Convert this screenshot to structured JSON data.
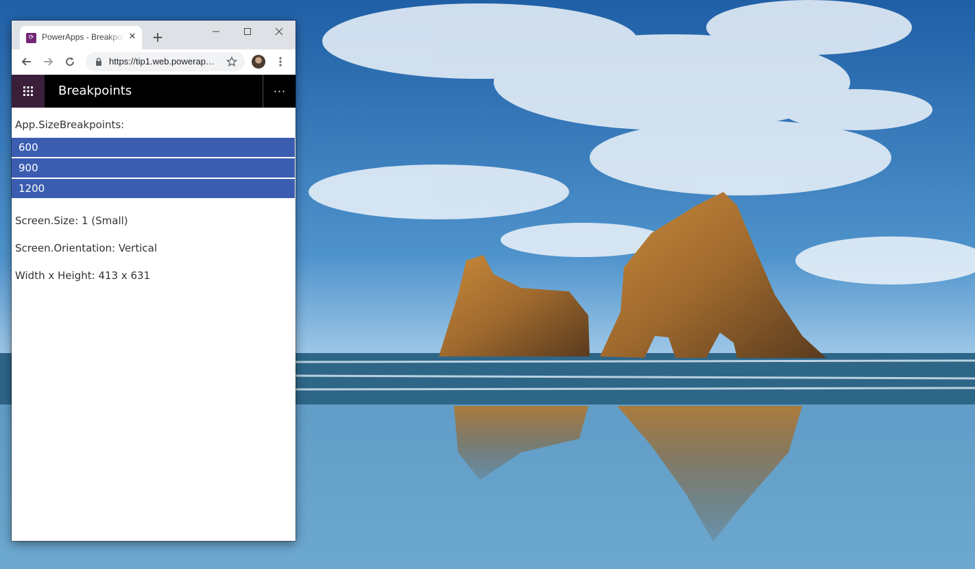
{
  "browser": {
    "tab_title": "PowerApps - Breakpoints",
    "tab_favicon": "powerapps-icon",
    "url": "https://tip1.web.powerapps.com",
    "icons": [
      "back-arrow-icon",
      "forward-arrow-icon",
      "reload-icon",
      "lock-icon",
      "star-icon",
      "profile-avatar",
      "more-menu-icon",
      "close-icon",
      "plus-icon",
      "minimize-icon",
      "maximize-icon"
    ]
  },
  "app": {
    "title": "Breakpoints",
    "more_label": "···",
    "breakpoints_label": "App.SizeBreakpoints:",
    "breakpoints": [
      "600",
      "900",
      "1200"
    ],
    "screen_size": "Screen.Size: 1 (Small)",
    "screen_orientation": "Screen.Orientation: Vertical",
    "dimensions": "Width x Height: 413 x 631"
  },
  "colors": {
    "header_bg": "#000000",
    "waffle_bg": "#3b1f3a",
    "breakpoint_bg": "#3b5db0"
  }
}
